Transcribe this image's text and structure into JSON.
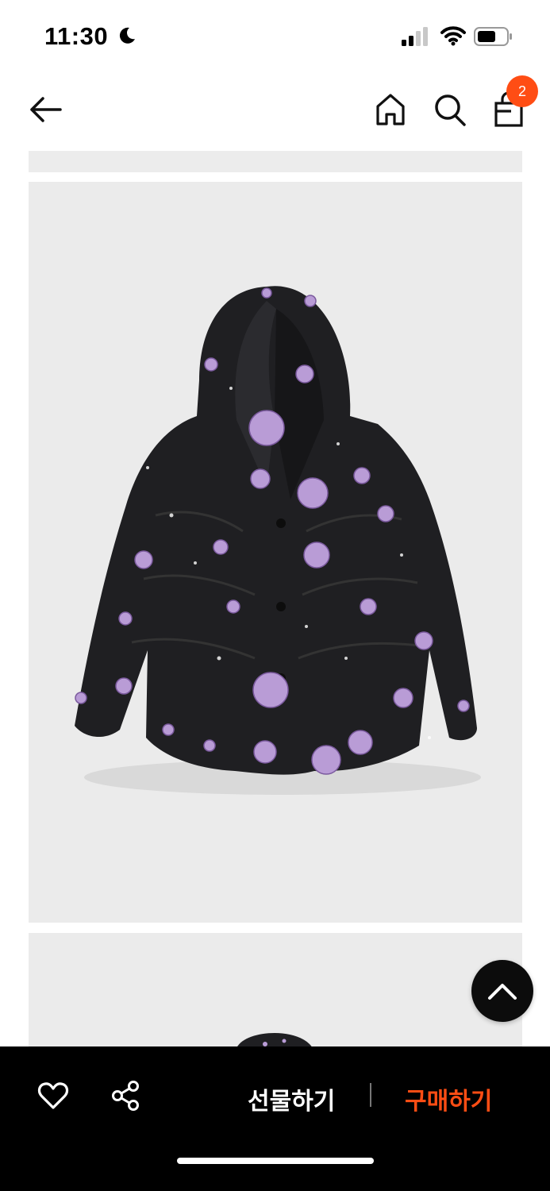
{
  "status": {
    "time": "11:30"
  },
  "nav": {
    "cart_count": "2"
  },
  "actions": {
    "gift_label": "선물하기",
    "buy_label": "구매하기"
  },
  "colors": {
    "accent": "#ff4d14",
    "bar": "#000000",
    "image_bg": "#ebebeb",
    "jacket": "#1e1e20",
    "flower": "#b99cd6"
  },
  "icons": [
    "moon-icon",
    "signal-icon",
    "wifi-icon",
    "battery-icon",
    "back-arrow-icon",
    "home-icon",
    "search-icon",
    "shopping-bag-icon",
    "chevron-up-icon",
    "heart-icon",
    "share-icon"
  ]
}
